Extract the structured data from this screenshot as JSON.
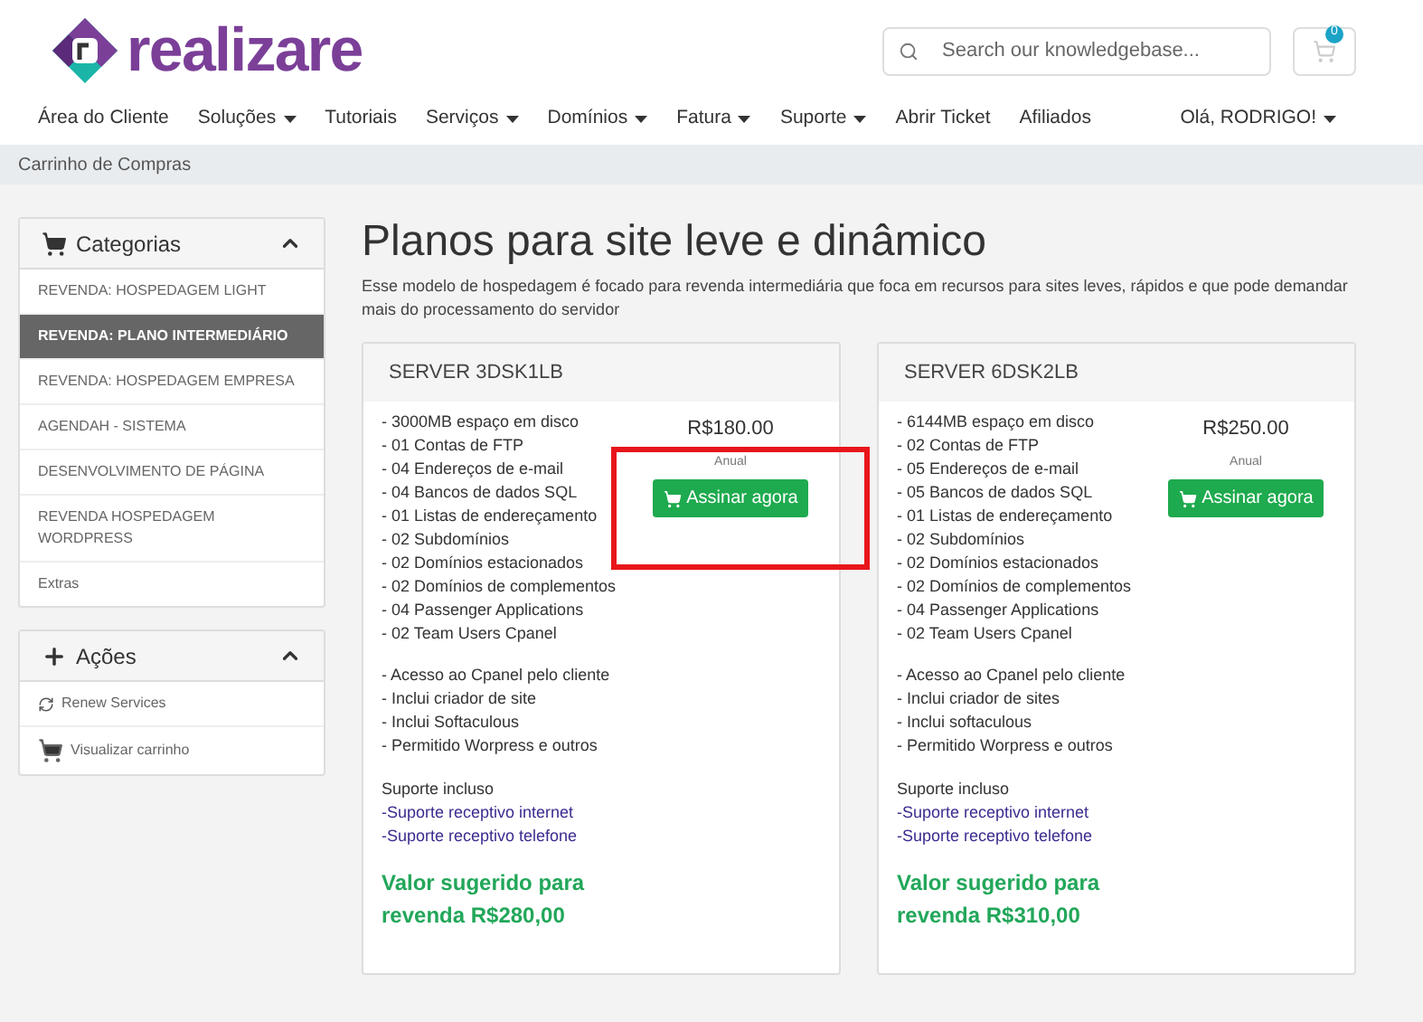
{
  "logo": {
    "text": "realizare"
  },
  "search": {
    "placeholder": "Search our knowledgebase..."
  },
  "cart": {
    "count": "0"
  },
  "nav": [
    {
      "label": "Área do Cliente",
      "dropdown": false
    },
    {
      "label": "Soluções",
      "dropdown": true
    },
    {
      "label": "Tutoriais",
      "dropdown": false
    },
    {
      "label": "Serviços",
      "dropdown": true
    },
    {
      "label": "Domínios",
      "dropdown": true
    },
    {
      "label": "Fatura",
      "dropdown": true
    },
    {
      "label": "Suporte",
      "dropdown": true
    },
    {
      "label": "Abrir Ticket",
      "dropdown": false
    },
    {
      "label": "Afiliados",
      "dropdown": false
    }
  ],
  "user_menu": {
    "label": "Olá, RODRIGO!",
    "dropdown": true
  },
  "breadcrumb": "Carrinho de Compras",
  "sidebar": [
    {
      "title": "Categorias",
      "kind": "cart",
      "items": [
        {
          "label": "REVENDA: HOSPEDAGEM LIGHT",
          "selected": false
        },
        {
          "label": "REVENDA: PLANO INTERMEDIÁRIO",
          "selected": true
        },
        {
          "label": "REVENDA: HOSPEDAGEM EMPRESA",
          "selected": false
        },
        {
          "label": "AGENDAH - SISTEMA",
          "selected": false
        },
        {
          "label": "DESENVOLVIMENTO DE PÁGINA",
          "selected": false
        },
        {
          "label": "REVENDA HOSPEDAGEM WORDPRESS",
          "selected": false
        },
        {
          "label": "Extras",
          "selected": false
        }
      ]
    },
    {
      "title": "Ações",
      "kind": "plus",
      "items": [
        {
          "label": "Renew Services",
          "kind": "refresh",
          "selected": false
        },
        {
          "label": "Visualizar carrinho",
          "kind": "cart",
          "selected": false
        }
      ]
    }
  ],
  "page": {
    "title": "Planos para site leve e dinâmico",
    "description": "Esse modelo de hospedagem é focado para revenda intermediária que foca em recursos para sites leves, rápidos e que pode demandar mais do processamento do servidor"
  },
  "plans": [
    {
      "name": "SERVER 3DSK1LB",
      "price": "R$180.00",
      "cycle": "Anual",
      "button": "Assinar agora",
      "highlighted": true,
      "features": [
        "- 3000MB espaço em disco",
        "- 01 Contas de FTP",
        "- 04 Endereços de e-mail",
        "- 04 Bancos de dados SQL",
        "- 01 Listas de endereçamento",
        "- 02 Subdomínios",
        "- 02 Domínios estacionados",
        "- 02 Domínios de complementos",
        "- 04 Passenger Applications",
        "- 02 Team Users Cpanel"
      ],
      "extras": [
        "- Acesso ao Cpanel pelo cliente",
        "- Inclui criador de site",
        "- Inclui Softaculous",
        "- Permitido Worpress e outros"
      ],
      "support_title": "Suporte incluso",
      "support": [
        "-Suporte receptivo internet",
        "-Suporte receptivo telefone"
      ],
      "suggested": "Valor sugerido para revenda R$280,00"
    },
    {
      "name": "SERVER 6DSK2LB",
      "price": "R$250.00",
      "cycle": "Anual",
      "button": "Assinar agora",
      "highlighted": false,
      "features": [
        "- 6144MB espaço em disco",
        "- 02 Contas de FTP",
        "- 05 Endereços de e-mail",
        "- 05 Bancos de dados SQL",
        "- 01 Listas de endereçamento",
        "- 02 Subdomínios",
        "- 02 Domínios estacionados",
        "- 02 Domínios de complementos",
        "- 04 Passenger Applications",
        "- 02 Team Users Cpanel"
      ],
      "extras": [
        "- Acesso ao Cpanel pelo cliente",
        "- Inclui criador de sites",
        "- Inclui softaculous",
        "- Permitido Worpress e outros"
      ],
      "support_title": "Suporte incluso",
      "support": [
        "-Suporte receptivo internet",
        "-Suporte receptivo telefone"
      ],
      "suggested": "Valor sugerido para revenda R$310,00"
    }
  ]
}
